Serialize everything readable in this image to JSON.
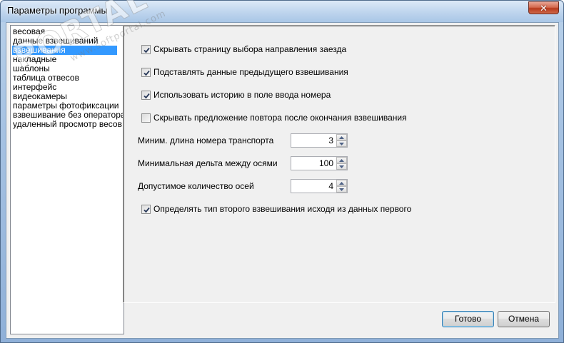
{
  "window": {
    "title": "Параметры программы",
    "close_symbol": "✕"
  },
  "sidebar": {
    "items": [
      {
        "label": "весовая",
        "selected": false
      },
      {
        "label": "данные взвешиваний",
        "selected": false
      },
      {
        "label": "взвешивания",
        "selected": true
      },
      {
        "label": "накладные",
        "selected": false
      },
      {
        "label": "шаблоны",
        "selected": false
      },
      {
        "label": "таблица отвесов",
        "selected": false
      },
      {
        "label": "интерфейс",
        "selected": false
      },
      {
        "label": "видеокамеры",
        "selected": false
      },
      {
        "label": "параметры фотофиксации",
        "selected": false
      },
      {
        "label": "взвешивание без оператора",
        "selected": false
      },
      {
        "label": "удаленный просмотр весов",
        "selected": false
      }
    ]
  },
  "settings": {
    "checks": [
      {
        "label": "Скрывать страницу выбора направления заезда",
        "checked": true
      },
      {
        "label": "Подставлять данные предыдущего взвешивания",
        "checked": true
      },
      {
        "label": "Использовать историю в поле ввода номера",
        "checked": true
      },
      {
        "label": "Скрывать предложение повтора после окончания взвешивания",
        "checked": false
      }
    ],
    "fields": [
      {
        "label": "Миним. длина номера транспорта",
        "value": "3"
      },
      {
        "label": "Минимальная дельта между осями",
        "value": "100"
      },
      {
        "label": "Допустимое количество осей",
        "value": "4"
      }
    ],
    "final_check": {
      "label": "Определять тип второго взвешивания исходя из данных первого",
      "checked": true
    }
  },
  "buttons": {
    "ok": "Готово",
    "cancel": "Отмена"
  },
  "watermark": {
    "main": "PORTAL",
    "sub": "www.softportal.com",
    "mark": "TM"
  },
  "colors": {
    "selection": "#3399ff",
    "title_bar": "#c3d8ef",
    "close_button": "#c7472a"
  }
}
